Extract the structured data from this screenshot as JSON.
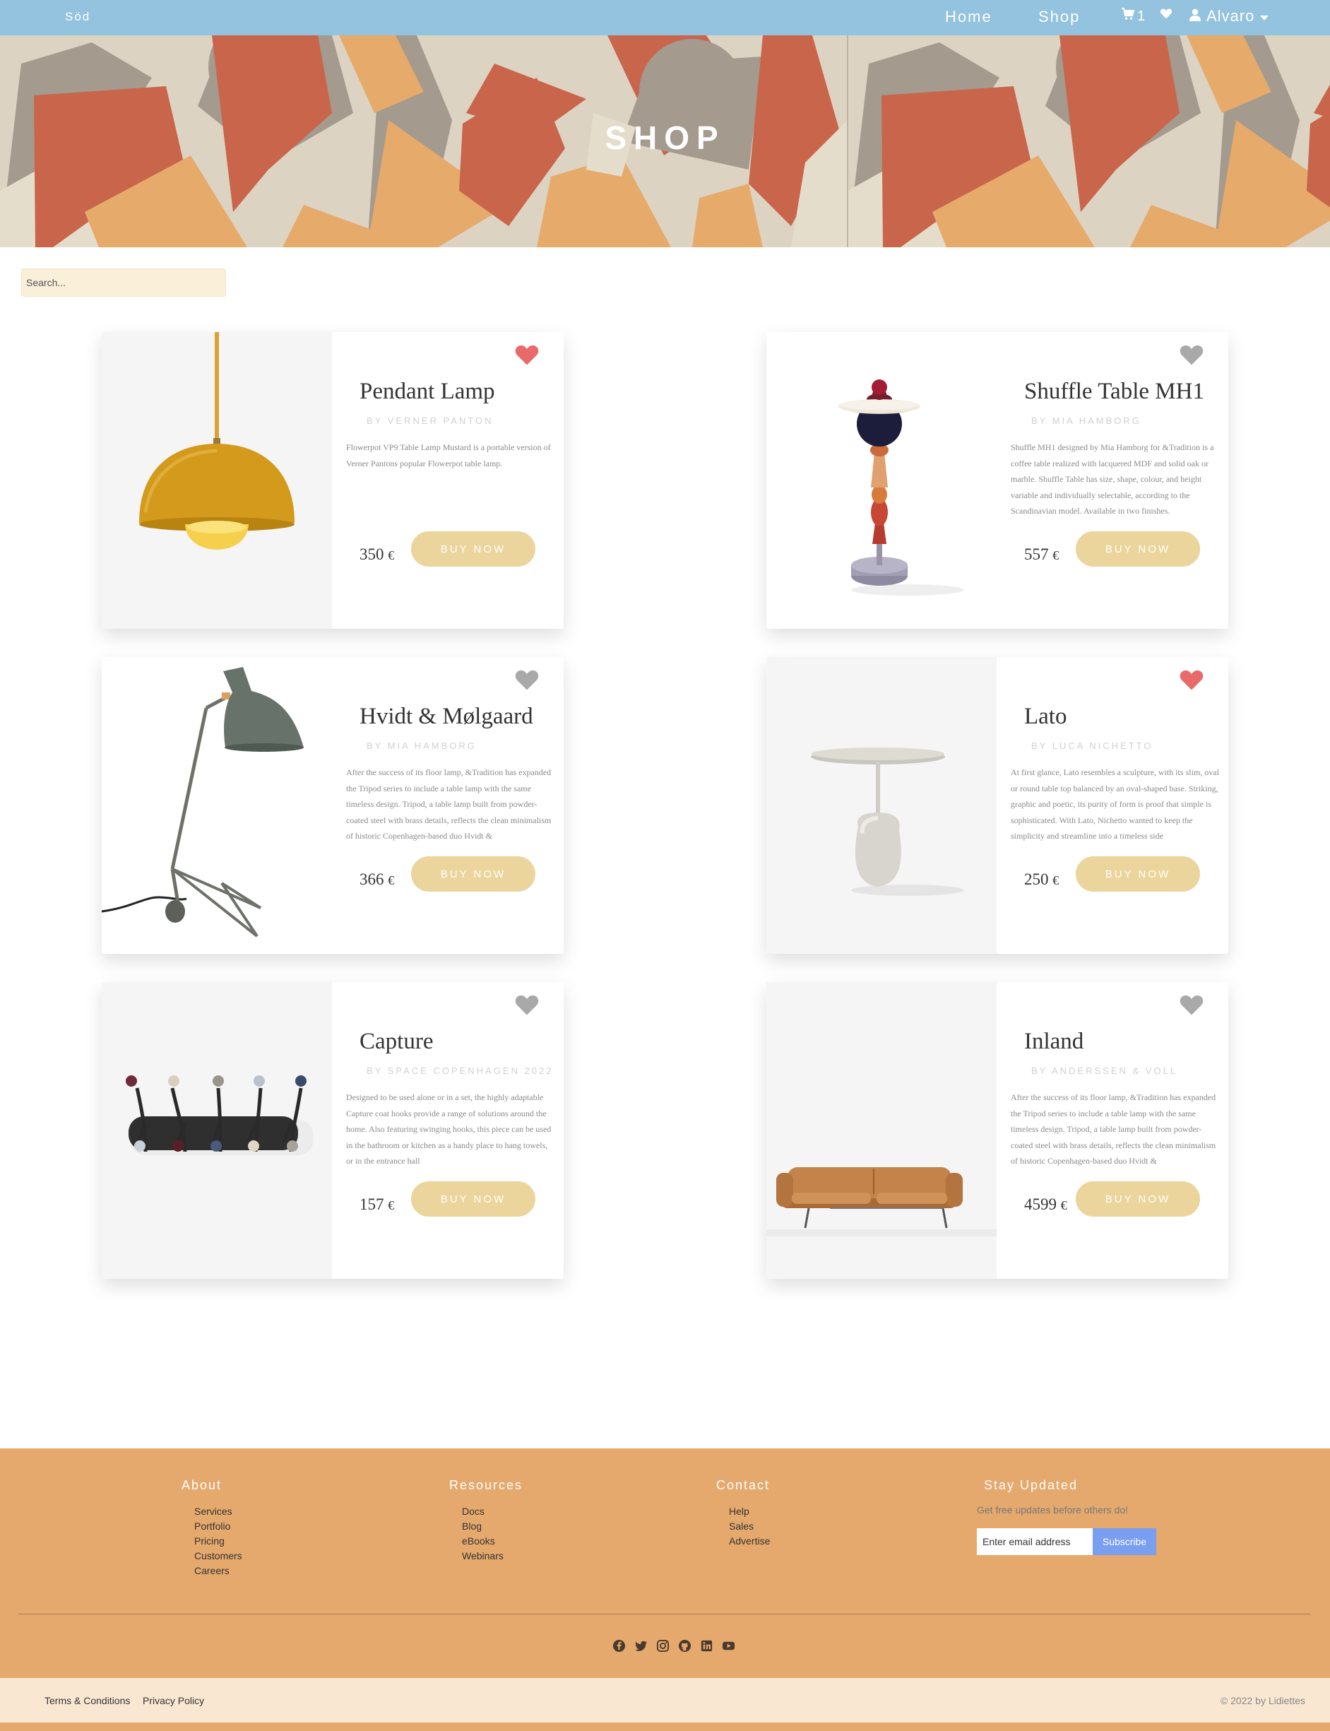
{
  "navbar": {
    "brand": "Söd",
    "links": [
      "Home",
      "Shop"
    ],
    "cart_count": "1",
    "user_name": "Alvaro"
  },
  "hero": {
    "title": "SHOP"
  },
  "search": {
    "placeholder": "Search..."
  },
  "products": [
    {
      "title": "Pendant Lamp",
      "author": "BY VERNER PANTON",
      "description": "Flowerpot VP9 Table Lamp Mustard is a portable version of Verner Pantons popular Flowerpot table lamp.",
      "price": "350",
      "currency": "€",
      "button": "BUY NOW",
      "favorite": true
    },
    {
      "title": "Shuffle Table MH1",
      "author": "BY MIA HAMBORG",
      "description": "Shuffle MH1 designed by Mia Hamborg for &Tradition is a coffee table realized with lacquered MDF and solid oak or marble. Shuffle Table has size, shape, colour, and height variable and individually selectable, according to the Scandinavian model. Available in two finishes.",
      "price": "557",
      "currency": "€",
      "button": "BUY NOW",
      "favorite": false
    },
    {
      "title": "Hvidt & Mølgaard",
      "author": "BY MIA HAMBORG",
      "description": "After the success of its floor lamp, &Tradition has expanded the Tripod series to include a table lamp with the same timeless design. Tripod, a table lamp built from powder-coated steel with brass details, reflects the clean minimalism of historic Copenhagen-based duo Hvidt &",
      "price": "366",
      "currency": "€",
      "button": "BUY NOW",
      "favorite": false
    },
    {
      "title": "Lato",
      "author": "BY LUCA NICHETTO",
      "description": "At first glance, Lato resembles a sculpture, with its slim, oval or round table top balanced by an oval-shaped base. Striking, graphic and poetic, its purity of form is proof that simple is sophisticated. With Lato, Nichetto wanted to keep the simplicity and streamline into a timeless side",
      "price": "250",
      "currency": "€",
      "button": "BUY NOW",
      "favorite": true
    },
    {
      "title": "Capture",
      "author": "BY SPACE COPENHAGEN 2022",
      "description": "Designed to be used alone or in a set, the highly adaptable Capture coat hooks provide a range of solutions around the home. Also featuring swinging hooks, this piece can be used in the bathroom or kitchen as a handy place to hang towels, or in the entrance hall",
      "price": "157",
      "currency": "€",
      "button": "BUY NOW",
      "favorite": false
    },
    {
      "title": "Inland",
      "author": "BY ANDERSSEN & VOLL",
      "description": "After the success of its floor lamp, &Tradition has expanded the Tripod series to include a table lamp with the same timeless design. Tripod, a table lamp built from powder-coated steel with brass details, reflects the clean minimalism of historic Copenhagen-based duo Hvidt &",
      "price": "4599",
      "currency": "€",
      "button": "BUY NOW",
      "favorite": false
    }
  ],
  "footer": {
    "columns": [
      {
        "title": "About",
        "items": [
          "Services",
          "Portfolio",
          "Pricing",
          "Customers",
          "Careers"
        ]
      },
      {
        "title": "Resources",
        "items": [
          "Docs",
          "Blog",
          "eBooks",
          "Webinars"
        ]
      },
      {
        "title": "Contact",
        "items": [
          "Help",
          "Sales",
          "Advertise"
        ]
      }
    ],
    "stay_updated": {
      "title": "Stay Updated",
      "subtitle": "Get free updates before others do!",
      "email_placeholder": "Enter email address",
      "button": "Subscribe"
    },
    "socials": [
      "facebook-icon",
      "twitter-icon",
      "instagram-icon",
      "github-icon",
      "linkedin-icon",
      "youtube-icon"
    ],
    "bottom_links": [
      "Terms & Conditions",
      "Privacy Policy"
    ],
    "copyright": "© 2022 by Lidiettes"
  },
  "colors": {
    "navbar": "#94c3df",
    "footer": "#e5a96d",
    "button": "#ecd59c",
    "favorite_active": "#e86a6a",
    "favorite_inactive": "#a9a9a9",
    "subscribe": "#7a9ef0",
    "bottom_bar": "#fae7d2"
  }
}
